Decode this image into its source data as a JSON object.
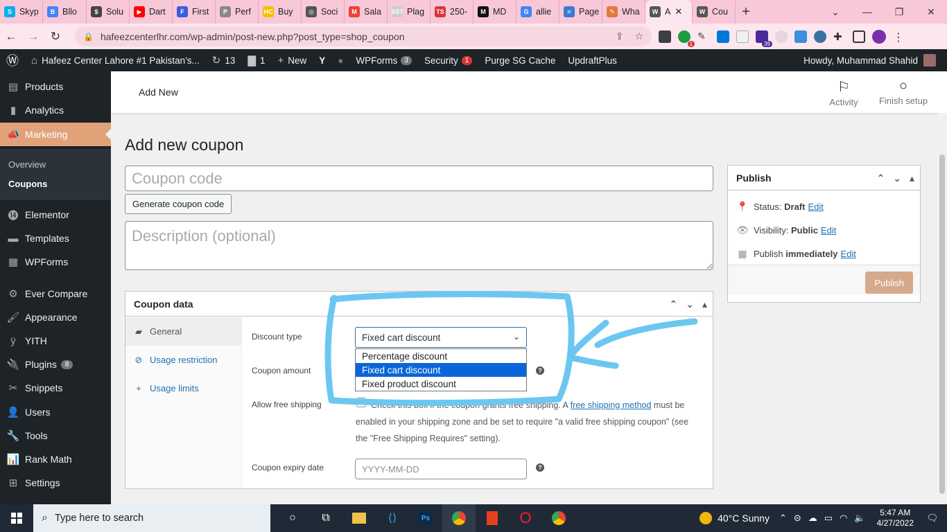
{
  "browser": {
    "tabs": [
      {
        "label": "Skyp",
        "fav_color": "#00aff0",
        "fav_text": "S"
      },
      {
        "label": "Bllo",
        "fav_color": "#4285f4",
        "fav_text": "B"
      },
      {
        "label": "Solu",
        "fav_color": "#444444",
        "fav_text": "$"
      },
      {
        "label": "Dart",
        "fav_color": "#ff0000",
        "fav_text": "▶"
      },
      {
        "label": "First",
        "fav_color": "#3b5bdb",
        "fav_text": "F"
      },
      {
        "label": "Perf",
        "fav_color": "#888888",
        "fav_text": "P"
      },
      {
        "label": "Buy",
        "fav_color": "#f5c000",
        "fav_text": "HC"
      },
      {
        "label": "Soci",
        "fav_color": "#555555",
        "fav_text": "◎"
      },
      {
        "label": "Sala",
        "fav_color": "#ea4335",
        "fav_text": "M"
      },
      {
        "label": "Plag",
        "fav_color": "#cccccc",
        "fav_text": "SST"
      },
      {
        "label": "250-",
        "fav_color": "#d63638",
        "fav_text": "TS"
      },
      {
        "label": "MD",
        "fav_color": "#111111",
        "fav_text": "M"
      },
      {
        "label": "allie",
        "fav_color": "#4285f4",
        "fav_text": "G"
      },
      {
        "label": "Page",
        "fav_color": "#3a7bd5",
        "fav_text": "≈"
      },
      {
        "label": "Wha",
        "fav_color": "#e07b39",
        "fav_text": "✎"
      },
      {
        "label": "A",
        "fav_color": "#555555",
        "fav_text": "W",
        "active": true
      },
      {
        "label": "Cou",
        "fav_color": "#555555",
        "fav_text": "W"
      }
    ],
    "url": "hafeezcenterlhr.com/wp-admin/post-new.php?post_type=shop_coupon",
    "ext_badge": "1",
    "ext_badge2": "39"
  },
  "adminbar": {
    "site_name": "Hafeez Center Lahore #1 Pakistan's...",
    "updates": "13",
    "comments": "1",
    "new_label": "New",
    "wpforms_label": "WPForms",
    "wpforms_count": "3",
    "security_label": "Security",
    "security_count": "1",
    "purge_label": "Purge SG Cache",
    "updraft_label": "UpdraftPlus",
    "howdy": "Howdy, Muhammad Shahid"
  },
  "sidebar": {
    "items": [
      {
        "label": "Products",
        "icon": "products-icon",
        "glyph": "▤"
      },
      {
        "label": "Analytics",
        "icon": "analytics-icon",
        "glyph": "▮"
      },
      {
        "label": "Marketing",
        "icon": "marketing-icon",
        "glyph": "📣"
      },
      {
        "label": "Elementor",
        "icon": "elementor-icon",
        "glyph": "⓮"
      },
      {
        "label": "Templates",
        "icon": "templates-icon",
        "glyph": "▬"
      },
      {
        "label": "WPForms",
        "icon": "wpforms-icon",
        "glyph": "▦"
      },
      {
        "label": "Ever Compare",
        "icon": "ever-compare-icon",
        "glyph": "⚙"
      },
      {
        "label": "Appearance",
        "icon": "appearance-icon",
        "glyph": "🖌"
      },
      {
        "label": "YITH",
        "icon": "yith-icon",
        "glyph": "ÿ"
      },
      {
        "label": "Plugins",
        "icon": "plugins-icon",
        "glyph": "🔌",
        "count": "8"
      },
      {
        "label": "Snippets",
        "icon": "snippets-icon",
        "glyph": "✂"
      },
      {
        "label": "Users",
        "icon": "users-icon",
        "glyph": "👤"
      },
      {
        "label": "Tools",
        "icon": "tools-icon",
        "glyph": "🔧"
      },
      {
        "label": "Rank Math",
        "icon": "rank-math-icon",
        "glyph": "📊"
      },
      {
        "label": "Settings",
        "icon": "settings-icon",
        "glyph": "⊞"
      }
    ],
    "sub_overview": "Overview",
    "sub_coupons": "Coupons"
  },
  "wc_header": {
    "title": "Add New",
    "activity": "Activity",
    "finish_setup": "Finish setup"
  },
  "main": {
    "page_title": "Add new coupon",
    "coupon_code_placeholder": "Coupon code",
    "generate_label": "Generate coupon code",
    "description_placeholder": "Description (optional)"
  },
  "coupon_data": {
    "title": "Coupon data",
    "tabs": [
      {
        "label": "General",
        "glyph": "▰",
        "icon": "general-icon"
      },
      {
        "label": "Usage restriction",
        "glyph": "⊘",
        "icon": "usage-restriction-icon"
      },
      {
        "label": "Usage limits",
        "glyph": "+",
        "icon": "usage-limits-icon"
      }
    ],
    "discount_type_label": "Discount type",
    "discount_type_value": "Fixed cart discount",
    "discount_options": [
      "Percentage discount",
      "Fixed cart discount",
      "Fixed product discount"
    ],
    "selected_option": 1,
    "coupon_amount_label": "Coupon amount",
    "free_shipping_label": "Allow free shipping",
    "free_shipping_text_before": "Check this box if the coupon grants free shipping. A ",
    "free_shipping_link": "free shipping method",
    "free_shipping_text_after": " must be enabled in your shipping zone and be set to require \"a valid free shipping coupon\" (see the \"Free Shipping Requires\" setting).",
    "expiry_label": "Coupon expiry date",
    "expiry_placeholder": "YYYY-MM-DD"
  },
  "publish": {
    "title": "Publish",
    "status_label": "Status:",
    "status_value": "Draft",
    "visibility_label": "Visibility:",
    "visibility_value": "Public",
    "publish_label": "Publish",
    "publish_when": "immediately",
    "edit": "Edit",
    "button": "Publish"
  },
  "taskbar": {
    "search_placeholder": "Type here to search",
    "weather": "40°C  Sunny",
    "time": "5:47 AM",
    "date": "4/27/2022"
  },
  "colors": {
    "accent_marketing": "#e1a27a",
    "annotation": "#6cc7f0",
    "link": "#2271b1"
  }
}
